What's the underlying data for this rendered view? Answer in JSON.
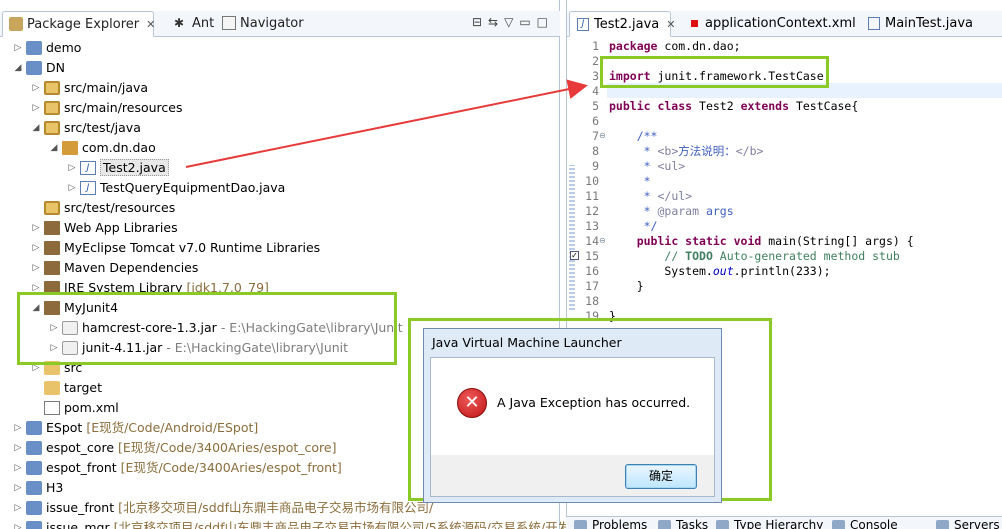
{
  "left": {
    "tabs": [
      {
        "label": "Package Explorer"
      },
      {
        "label": "Ant"
      },
      {
        "label": "Navigator"
      }
    ],
    "tree": [
      {
        "label": "demo",
        "icon": "project-icon",
        "twisty": "▷"
      },
      {
        "label": "DN",
        "icon": "project-icon",
        "twisty": "◢"
      },
      {
        "label": "src/main/java",
        "icon": "source-folder-icon",
        "twisty": "▷"
      },
      {
        "label": "src/main/resources",
        "icon": "source-folder-icon",
        "twisty": "▷"
      },
      {
        "label": "src/test/java",
        "icon": "source-folder-icon",
        "twisty": "◢"
      },
      {
        "label": "com.dn.dao",
        "icon": "package-icon",
        "twisty": "◢"
      },
      {
        "label": "Test2.java",
        "icon": "java-file-icon",
        "twisty": "▷"
      },
      {
        "label": "TestQueryEquipmentDao.java",
        "icon": "java-file-icon",
        "twisty": "▷"
      },
      {
        "label": "src/test/resources",
        "icon": "source-folder-icon",
        "twisty": ""
      },
      {
        "label": "Web App Libraries",
        "icon": "library-icon",
        "twisty": "▷"
      },
      {
        "label": "MyEclipse Tomcat v7.0 Runtime Libraries",
        "icon": "library-icon",
        "twisty": "▷"
      },
      {
        "label": "Maven Dependencies",
        "icon": "library-icon",
        "twisty": "▷"
      },
      {
        "label": "JRE System Library",
        "decoration": "[jdk1.7.0_79]",
        "icon": "library-icon",
        "twisty": "▷"
      },
      {
        "label": "MyJunit4",
        "icon": "library-icon",
        "twisty": "◢"
      },
      {
        "label": "hamcrest-core-1.3.jar",
        "decoration": "- E:\\HackingGate\\library\\Junit",
        "icon": "jar-icon",
        "twisty": "▷"
      },
      {
        "label": "junit-4.11.jar",
        "decoration": "- E:\\HackingGate\\library\\Junit",
        "icon": "jar-icon",
        "twisty": "▷"
      },
      {
        "label": "src",
        "icon": "folder-icon",
        "twisty": "▷"
      },
      {
        "label": "target",
        "icon": "folder-icon",
        "twisty": ""
      },
      {
        "label": "pom.xml",
        "icon": "xml-file-icon",
        "twisty": ""
      },
      {
        "label": "ESpot",
        "decoration": "[E现货/Code/Android/ESpot]",
        "icon": "project-icon",
        "twisty": "▷"
      },
      {
        "label": "espot_core",
        "decoration": "[E现货/Code/3400Aries/espot_core]",
        "icon": "project-icon",
        "twisty": "▷"
      },
      {
        "label": "espot_front",
        "decoration": "[E现货/Code/3400Aries/espot_front]",
        "icon": "project-icon",
        "twisty": "▷"
      },
      {
        "label": "H3",
        "icon": "project-icon",
        "twisty": "▷"
      },
      {
        "label": "issue_front",
        "decoration": "[北京移交项目/sddf山东鼎丰商品电子交易市场有限公司/",
        "icon": "project-icon",
        "twisty": "▷"
      },
      {
        "label": "issue_mgr",
        "decoration": "[北京移交项目/sddf山东鼎丰商品电子交易市场有限公司/5系统源码/交易系统/开发环",
        "icon": "project-icon",
        "twisty": "▷"
      }
    ]
  },
  "editor": {
    "tabs": [
      {
        "label": "Test2.java"
      },
      {
        "label": "applicationContext.xml"
      },
      {
        "label": "MainTest.java"
      }
    ],
    "lines": [
      {
        "n": "1",
        "html": "<span class='kw'>package</span> com.dn.dao;"
      },
      {
        "n": "2",
        "html": ""
      },
      {
        "n": "3",
        "html": "<span class='kw'>import</span> junit.framework.TestCase;"
      },
      {
        "n": "4",
        "html": ""
      },
      {
        "n": "5",
        "html": "<span class='kw'>public class</span> Test2 <span class='kw'>extends</span> TestCase{"
      },
      {
        "n": "6",
        "html": ""
      },
      {
        "n": "7",
        "html": "    <span class='jd'>/**</span>"
      },
      {
        "n": "8",
        "html": "<span class='jd'>     * <span class='tag'>&lt;b&gt;</span>方法说明：<span class='tag'>&lt;/b&gt;</span></span>"
      },
      {
        "n": "9",
        "html": "<span class='jd'>     * <span class='tag'>&lt;ul&gt;</span></span>"
      },
      {
        "n": "10",
        "html": "<span class='jd'>     *</span>"
      },
      {
        "n": "11",
        "html": "<span class='jd'>     * <span class='tag'>&lt;/ul&gt;</span></span>"
      },
      {
        "n": "12",
        "html": "<span class='jd'>     * <span class='tag'>@param</span> args</span>"
      },
      {
        "n": "13",
        "html": "<span class='jd'>     */</span>"
      },
      {
        "n": "14",
        "html": "    <span class='kw'>public static void</span> main(String[] args) {"
      },
      {
        "n": "15",
        "html": "        <span class='cm'>// <b>TODO</b> Auto-generated method stub</span>"
      },
      {
        "n": "16",
        "html": "        System.<span class='ital'>out</span>.println(233);"
      },
      {
        "n": "17",
        "html": "    }"
      },
      {
        "n": "18",
        "html": ""
      },
      {
        "n": "19",
        "html": "}"
      }
    ]
  },
  "bottom_tabs": [
    {
      "label": "Problems"
    },
    {
      "label": "Tasks"
    },
    {
      "label": "Type Hierarchy"
    },
    {
      "label": "Console"
    },
    {
      "label": "Servers"
    }
  ],
  "dialog": {
    "title": "Java Virtual Machine Launcher",
    "message": "A Java Exception has occurred.",
    "ok_label": "确定"
  },
  "colors": {
    "highlight_box": "#8ac926",
    "arrow": "#e83a3a",
    "keyword": "#7f0055",
    "comment": "#3f7f5f",
    "javadoc": "#3f5fbf"
  }
}
